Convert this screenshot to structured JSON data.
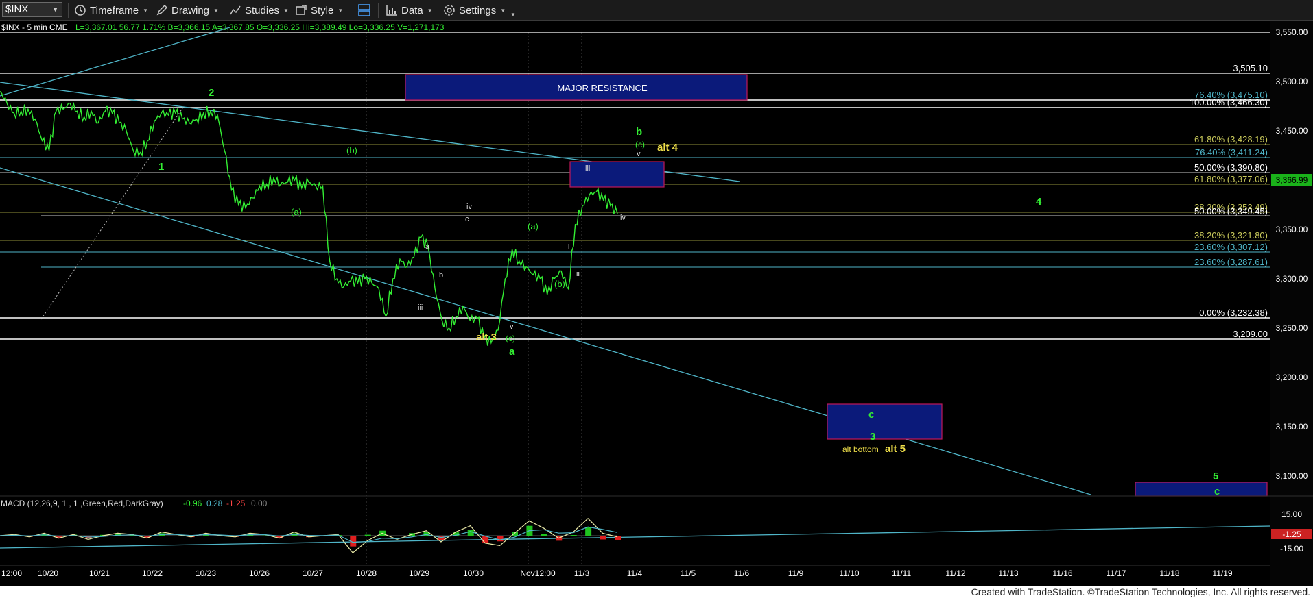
{
  "toolbar": {
    "symbol": "$INX",
    "timeframe": "Timeframe",
    "drawing": "Drawing",
    "studies": "Studies",
    "style": "Style",
    "data": "Data",
    "settings": "Settings"
  },
  "header": {
    "symbol_line": "$INX - 5 min  CME",
    "quote": "L=3,367.01  56.77  1.71%  B=3,366.15  A=3,367.85  O=3,336.25  Hi=3,389.49  Lo=3,336.25  V=1,271,173"
  },
  "footer": {
    "text": "Created with TradeStation. ©TradeStation Technologies, Inc. All rights reserved."
  },
  "colors": {
    "price": "#33ee33",
    "trend": "#4fb5c8",
    "box": "#0b1a7a",
    "box_border": "#c0185a",
    "wave_yellow": "#f0e04a"
  },
  "chart_data": {
    "type": "line",
    "title": "$INX - 5 min",
    "ylim": [
      3050,
      3560
    ],
    "x": [
      "12:00",
      "10/20",
      "10/21",
      "10/22",
      "10/23",
      "10/26",
      "10/27",
      "10/28",
      "10/29",
      "10/30",
      "Nov12:00",
      "11/3",
      "11/4",
      "11/5",
      "11/6",
      "11/9",
      "11/10",
      "11/11",
      "11/12",
      "11/13",
      "11/16",
      "11/17",
      "11/18",
      "11/19"
    ],
    "y_ticks": [
      "3,550.00",
      "3,500.00",
      "3,450.00",
      "3,400.00",
      "3,350.00",
      "3,300.00",
      "3,250.00",
      "3,200.00",
      "3,150.00",
      "3,100.00"
    ],
    "last_price": "3,366.99",
    "series_points": [
      [
        0,
        3490
      ],
      [
        1,
        3478
      ],
      [
        2,
        3468
      ],
      [
        3,
        3470
      ],
      [
        4,
        3472
      ],
      [
        5,
        3462
      ],
      [
        6,
        3440
      ],
      [
        7,
        3430
      ],
      [
        8,
        3470
      ],
      [
        9,
        3472
      ],
      [
        10,
        3478
      ],
      [
        11,
        3470
      ],
      [
        12,
        3464
      ],
      [
        13,
        3470
      ],
      [
        14,
        3458
      ],
      [
        15,
        3470
      ],
      [
        16,
        3468
      ],
      [
        17,
        3458
      ],
      [
        18,
        3450
      ],
      [
        19,
        3430
      ],
      [
        20,
        3428
      ],
      [
        21,
        3440
      ],
      [
        22,
        3460
      ],
      [
        23,
        3468
      ],
      [
        24,
        3466
      ],
      [
        25,
        3468
      ],
      [
        26,
        3462
      ],
      [
        27,
        3458
      ],
      [
        28,
        3462
      ],
      [
        29,
        3468
      ],
      [
        30,
        3470
      ],
      [
        31,
        3466
      ],
      [
        32,
        3430
      ],
      [
        33,
        3390
      ],
      [
        34,
        3375
      ],
      [
        35,
        3372
      ],
      [
        36,
        3382
      ],
      [
        37,
        3394
      ],
      [
        38,
        3396
      ],
      [
        39,
        3402
      ],
      [
        40,
        3396
      ],
      [
        41,
        3398
      ],
      [
        42,
        3400
      ],
      [
        43,
        3392
      ],
      [
        44,
        3398
      ],
      [
        45,
        3394
      ],
      [
        46,
        3394
      ],
      [
        47,
        3318
      ],
      [
        48,
        3300
      ],
      [
        49,
        3292
      ],
      [
        50,
        3298
      ],
      [
        51,
        3296
      ],
      [
        52,
        3300
      ],
      [
        53,
        3296
      ],
      [
        54,
        3290
      ],
      [
        55,
        3262
      ],
      [
        56,
        3300
      ],
      [
        57,
        3320
      ],
      [
        58,
        3312
      ],
      [
        59,
        3322
      ],
      [
        60,
        3342
      ],
      [
        61,
        3332
      ],
      [
        62,
        3290
      ],
      [
        63,
        3258
      ],
      [
        64,
        3250
      ],
      [
        65,
        3262
      ],
      [
        66,
        3272
      ],
      [
        67,
        3258
      ],
      [
        68,
        3260
      ],
      [
        69,
        3240
      ],
      [
        70,
        3235
      ],
      [
        71,
        3248
      ],
      [
        72,
        3300
      ],
      [
        73,
        3330
      ],
      [
        74,
        3318
      ],
      [
        75,
        3312
      ],
      [
        76,
        3304
      ],
      [
        77,
        3300
      ],
      [
        78,
        3284
      ],
      [
        79,
        3300
      ],
      [
        80,
        3308
      ],
      [
        81,
        3290
      ],
      [
        82,
        3355
      ],
      [
        83,
        3374
      ],
      [
        84,
        3385
      ],
      [
        85,
        3388
      ],
      [
        86,
        3380
      ],
      [
        87,
        3374
      ],
      [
        88,
        3366
      ]
    ],
    "fib_levels": [
      {
        "label": "3,505.10"
      },
      {
        "label": "76.40% (3,475.10)"
      },
      {
        "label": "100.00% (3,466.30)"
      },
      {
        "label": "61.80% (3,428.19)"
      },
      {
        "label": "76.40% (3,411.24)"
      },
      {
        "label": "50.00% (3,390.80)"
      },
      {
        "label": "61.80% (3,377.06)"
      },
      {
        "label": "38.20% (3,353.49)"
      },
      {
        "label": "50.00% (3,349.45)"
      },
      {
        "label": "38.20% (3,321.80)"
      },
      {
        "label": "23.60% (3,307.12)"
      },
      {
        "label": "23.60% (3,287.61)"
      },
      {
        "label": "0.00% (3,232.38)"
      },
      {
        "label": "3,209.00"
      }
    ],
    "annotations": {
      "major_resistance": "MAJOR RESISTANCE",
      "wave_1": "1",
      "wave_2": "2",
      "wave_b_a": "(a)",
      "wave_b_b": "(b)",
      "wave_iii_1": "iii",
      "wave_a_lc": "a",
      "wave_b_lc": "b",
      "wave_iv_1": "iv",
      "wave_c_lc": "c",
      "wave_alt3": "alt 3",
      "wave_v_1": "v",
      "wave_c_paren": "(c)",
      "wave_a_big": "a",
      "wave_a2": "(a)",
      "wave_b2": "(b)",
      "wave_i": "i",
      "wave_ii": "ii",
      "wave_iii_2": "iii",
      "wave_iv_2": "iv",
      "wave_b_big": "b",
      "wave_c3": "(c)",
      "wave_v_2": "v",
      "wave_alt4": "alt 4",
      "wave_4": "4",
      "wave_c_big": "c",
      "wave_3": "3",
      "alt_bottom": "alt bottom",
      "alt_5": "alt 5",
      "wave_5": "5",
      "wave_c_last": "c"
    }
  },
  "macd": {
    "label": "MACD (12,26,9, 1 , 1 ,Green,Red,DarkGray)",
    "v1": "-0.96",
    "v2": "0.28",
    "v3": "-1.25",
    "v4": "0.00",
    "ticks": [
      "15.00",
      "-15.00"
    ],
    "current": "-1.25",
    "series": [
      0,
      1,
      -1,
      2,
      -2,
      1,
      -3,
      0,
      2,
      1,
      -2,
      3,
      1,
      -1,
      2,
      0,
      -1,
      2,
      1,
      -2,
      3,
      -1,
      0,
      1,
      -14,
      -4,
      2,
      -3,
      1,
      4,
      -5,
      3,
      8,
      -6,
      -8,
      2,
      12,
      6,
      -2,
      3,
      14,
      2,
      -1
    ]
  }
}
